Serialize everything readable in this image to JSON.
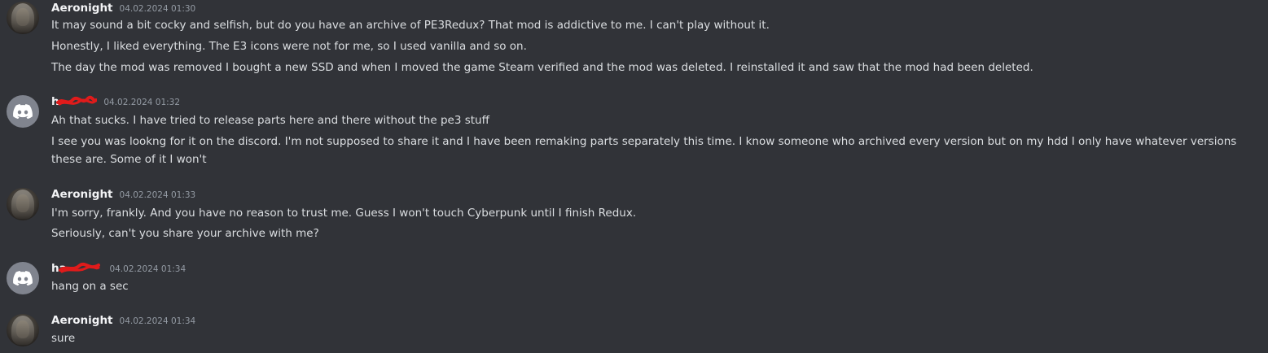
{
  "messages": [
    {
      "author": "Aeronight",
      "timestamp": "04.02.2024 01:30",
      "avatar": "user-photo-avatar",
      "lines": [
        "It may sound a bit cocky and selfish, but do you have an archive of PE3Redux? That mod is addictive to me. I can't play without it.",
        "Honestly, I liked everything. The E3 icons were not for me, so I used vanilla and so on.",
        "The day the mod was removed I bought a new SSD and when I moved the game Steam verified and the mod was deleted. I reinstalled it and saw that the mod had been deleted."
      ]
    },
    {
      "author": "h",
      "timestamp": "04.02.2024 01:32",
      "avatar": "discord-default-avatar",
      "lines": [
        "Ah that sucks. I have tried to release parts here and there without the pe3 stuff",
        "I see you was lookng for it on the discord. I'm not supposed to share it and I have been remaking parts separately this time. I know someone who archived every version but on my hdd I only have whatever versions these are. Some of it I won't"
      ]
    },
    {
      "author": "Aeronight",
      "timestamp": "04.02.2024 01:33",
      "avatar": "user-photo-avatar",
      "lines": [
        "I'm sorry, frankly. And you have no reason to trust me. Guess I won't touch Cyberpunk until I finish Redux.",
        "Seriously, can't you share your archive with me?"
      ]
    },
    {
      "author": "ha",
      "timestamp": "04.02.2024 01:34",
      "avatar": "discord-default-avatar",
      "lines": [
        "hang on a sec"
      ]
    },
    {
      "author": "Aeronight",
      "timestamp": "04.02.2024 01:34",
      "avatar": "user-photo-avatar",
      "lines": [
        "sure"
      ]
    }
  ],
  "colors": {
    "background": "#313338",
    "author": "#f2f3f5",
    "text": "#dbdee1",
    "timestamp": "#949ba4",
    "redaction": "#e01b1b",
    "discord_avatar_bg": "#80848e"
  }
}
